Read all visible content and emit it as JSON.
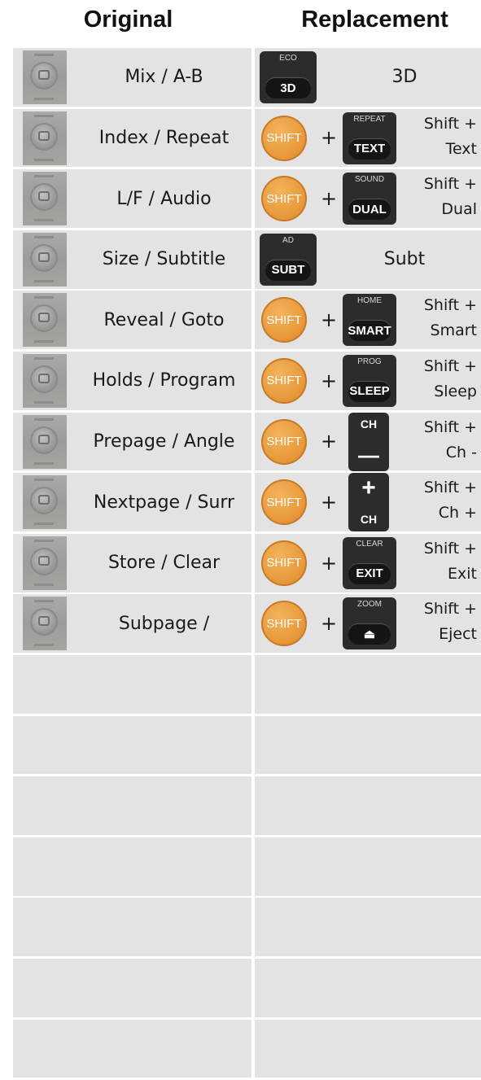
{
  "headers": {
    "original": "Original",
    "replacement": "Replacement"
  },
  "rows": [
    {
      "original": "Mix / A-B",
      "kind": "solo",
      "btn_top": "ECO",
      "btn_face": "3D",
      "label": "3D"
    },
    {
      "original": "Index / Repeat",
      "kind": "shift",
      "btn_top": "REPEAT",
      "btn_face": "TEXT",
      "line1": "Shift +",
      "line2": "Text"
    },
    {
      "original": "L/F / Audio",
      "kind": "shift",
      "btn_top": "SOUND",
      "btn_face": "DUAL",
      "line1": "Shift +",
      "line2": "Dual"
    },
    {
      "original": "Size / Subtitle",
      "kind": "solo",
      "btn_top": "AD",
      "btn_face": "SUBT",
      "label": "Subt"
    },
    {
      "original": "Reveal / Goto",
      "kind": "shift",
      "btn_top": "HOME",
      "btn_face": "SMART",
      "line1": "Shift +",
      "line2": "Smart"
    },
    {
      "original": "Holds / Program",
      "kind": "shift",
      "btn_top": "PROG",
      "btn_face": "SLEEP",
      "line1": "Shift +",
      "line2": "Sleep"
    },
    {
      "original": "Prepage / Angle",
      "kind": "shift",
      "btn_top": "CH",
      "btn_face": "—",
      "line1": "Shift +",
      "line2": "Ch -",
      "tall": true
    },
    {
      "original": "Nextpage / Surr",
      "kind": "shift",
      "btn_top": "+",
      "btn_face": "CH",
      "line1": "Shift +",
      "line2": "Ch +",
      "tall": true
    },
    {
      "original": "Store / Clear",
      "kind": "shift",
      "btn_top": "CLEAR",
      "btn_face": "EXIT",
      "line1": "Shift +",
      "line2": "Exit"
    },
    {
      "original": "Subpage /",
      "kind": "shift",
      "btn_top": "ZOOM",
      "btn_face": "⏏",
      "line1": "Shift +",
      "line2": "Eject"
    },
    {
      "original": "",
      "kind": "empty"
    },
    {
      "original": "",
      "kind": "empty"
    },
    {
      "original": "",
      "kind": "empty"
    },
    {
      "original": "",
      "kind": "empty"
    },
    {
      "original": "",
      "kind": "empty"
    },
    {
      "original": "",
      "kind": "empty"
    },
    {
      "original": "",
      "kind": "empty"
    }
  ],
  "shift_label": "SHIFT",
  "plus": "+",
  "colors": {
    "cell": "#e3e3e3",
    "shift_orange": "#e99a3b",
    "button_dark": "#2b2c2d"
  }
}
